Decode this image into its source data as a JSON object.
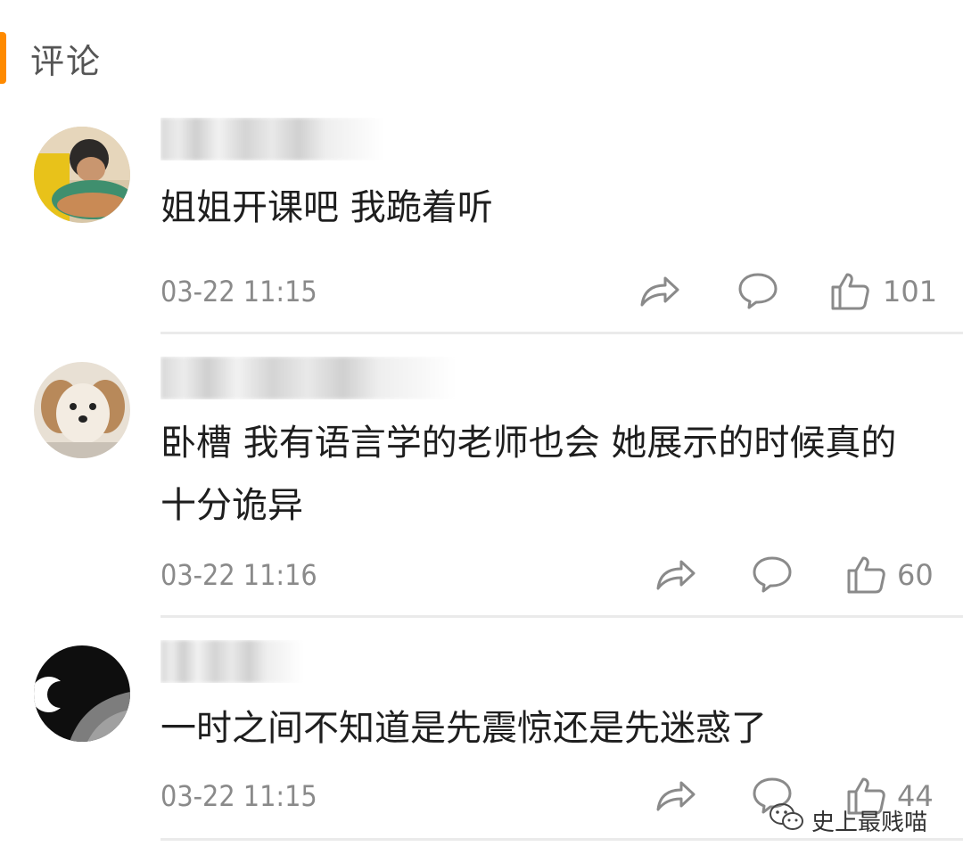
{
  "header": {
    "title": "评论",
    "accent_color": "#ff8a00"
  },
  "comments": [
    {
      "text_lines": [
        "姐姐开课吧 我跪着听"
      ],
      "time": "03-22 11:15",
      "likes": "101",
      "avatar_icon": "avatar-child-icon"
    },
    {
      "text_lines": [
        "卧槽 我有语言学的老师也会 她展示的时候真的",
        "十分诡异"
      ],
      "time": "03-22 11:16",
      "likes": "60",
      "avatar_icon": "avatar-dog-icon"
    },
    {
      "text_lines": [
        "一时之间不知道是先震惊还是先迷惑了"
      ],
      "time": "03-22 11:15",
      "likes": "44",
      "avatar_icon": "avatar-moon-icon"
    }
  ],
  "watermark": {
    "text": "史上最贱喵",
    "icon": "wechat-icon"
  }
}
